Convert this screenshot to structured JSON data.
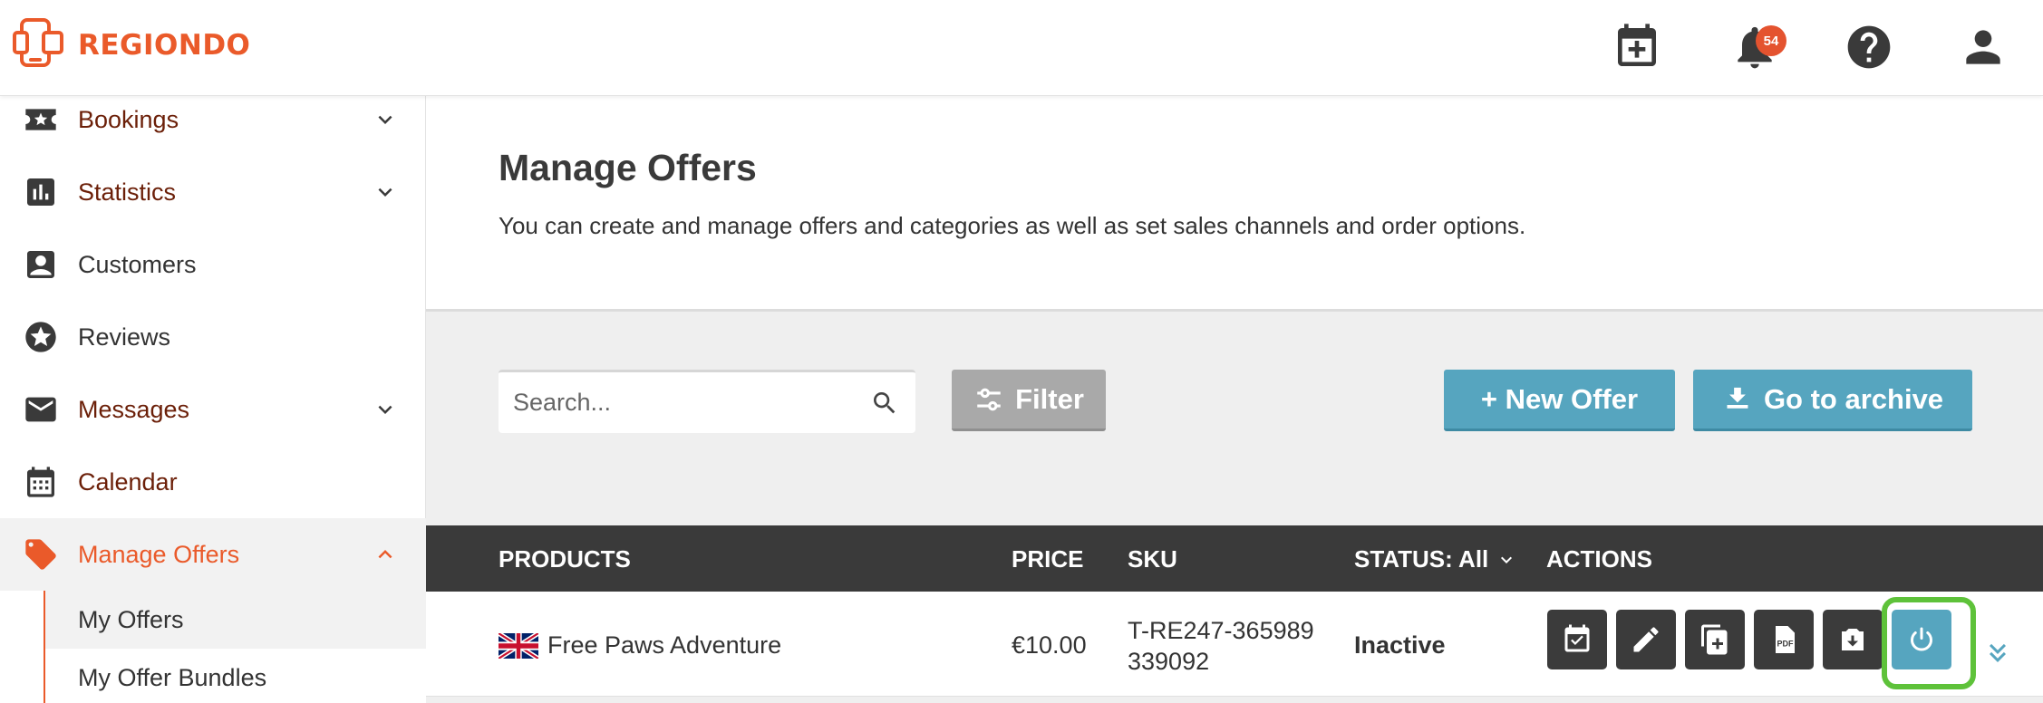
{
  "brand": {
    "name": "REGIONDO",
    "color": "#ea5a2a"
  },
  "topbar": {
    "icons": [
      "calendar-add-icon",
      "bell-icon",
      "help-icon",
      "user-icon"
    ],
    "notification_count": "54"
  },
  "sidebar": {
    "items": [
      {
        "label": "Bookings",
        "icon": "star-ticket-icon",
        "expandable": true
      },
      {
        "label": "Statistics",
        "icon": "bar-chart-icon",
        "expandable": true
      },
      {
        "label": "Customers",
        "icon": "contact-card-icon",
        "expandable": false
      },
      {
        "label": "Reviews",
        "icon": "star-circle-icon",
        "expandable": false
      },
      {
        "label": "Messages",
        "icon": "envelope-icon",
        "expandable": true
      },
      {
        "label": "Calendar",
        "icon": "calendar-icon",
        "expandable": false
      },
      {
        "label": "Manage Offers",
        "icon": "tag-icon",
        "expandable": true,
        "active": true
      }
    ],
    "subitems": [
      {
        "label": "My Offers",
        "current": true
      },
      {
        "label": "My Offer Bundles"
      }
    ]
  },
  "main": {
    "title": "Manage Offers",
    "description": "You can create and manage offers and categories as well as set sales channels and order options."
  },
  "toolbar": {
    "search_placeholder": "Search...",
    "filter_label": "Filter",
    "new_offer_label": "+ New Offer",
    "archive_label": "Go to archive"
  },
  "table": {
    "headers": {
      "products": "PRODUCTS",
      "price": "PRICE",
      "sku": "SKU",
      "status": "STATUS: All",
      "actions": "ACTIONS"
    },
    "rows": [
      {
        "product": "Free Paws Adventure",
        "flag": "uk-flag-icon",
        "price": "€10.00",
        "sku_line1": "T-RE247-365989",
        "sku_line2": "339092",
        "status": "Inactive",
        "actions": [
          "calendar-check-icon",
          "pencil-icon",
          "duplicate-icon",
          "pdf-icon",
          "archive-download-icon",
          "power-icon"
        ]
      }
    ]
  },
  "colors": {
    "accent": "#ea5a2a",
    "button_blue": "#56a5bf",
    "header_dark": "#3a3a3a",
    "highlight_green": "#5ec23a"
  }
}
